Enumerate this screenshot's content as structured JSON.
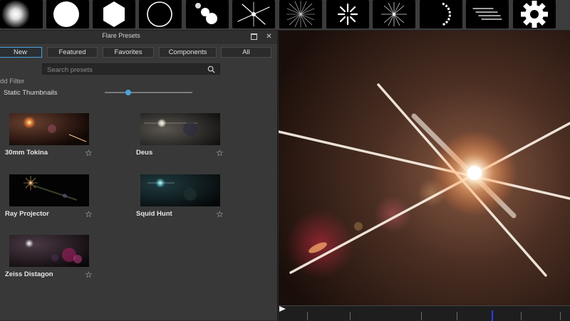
{
  "toolbar": {
    "elements": [
      {
        "name": "glow-element",
        "icon": "glow-icon"
      },
      {
        "name": "disc-element",
        "icon": "disc-icon"
      },
      {
        "name": "polygon-element",
        "icon": "hexagon-icon"
      },
      {
        "name": "ring-element",
        "icon": "ring-icon"
      },
      {
        "name": "multi-iris-element",
        "icon": "multi-iris-icon"
      },
      {
        "name": "streak-element",
        "icon": "streak-icon"
      },
      {
        "name": "spike-ball-element",
        "icon": "spike-ball-icon"
      },
      {
        "name": "shimmer-element",
        "icon": "shimmer-icon"
      },
      {
        "name": "sparkle-element",
        "icon": "sparkle-icon"
      },
      {
        "name": "caustic-element",
        "icon": "caustic-icon"
      },
      {
        "name": "lens-streaks-element",
        "icon": "lens-streaks-icon"
      },
      {
        "name": "settings-element",
        "icon": "gear-icon"
      }
    ]
  },
  "panel": {
    "title": "Flare Presets",
    "tabs": [
      {
        "label": "New",
        "active": true
      },
      {
        "label": "Featured",
        "active": false
      },
      {
        "label": "Favorites",
        "active": false
      },
      {
        "label": "Components",
        "active": false
      },
      {
        "label": "All",
        "active": false
      }
    ],
    "search": {
      "placeholder": "Search presets",
      "value": ""
    },
    "add_filter": "dd Filter",
    "static_thumbnails_label": "Static Thumbnails",
    "thumbnail_size_fraction": 0.27,
    "presets": [
      {
        "name": "30mm Tokina"
      },
      {
        "name": "Deus"
      },
      {
        "name": "Ray Projector"
      },
      {
        "name": "Squid Hunt"
      },
      {
        "name": "Zeiss Distagon"
      }
    ]
  },
  "timeline": {
    "playhead_fraction": 0.73
  },
  "colors": {
    "accent": "#4aa3df",
    "playhead": "#2a39ff",
    "flare_core": "#fff4dc",
    "background": "#2a2a2a"
  }
}
